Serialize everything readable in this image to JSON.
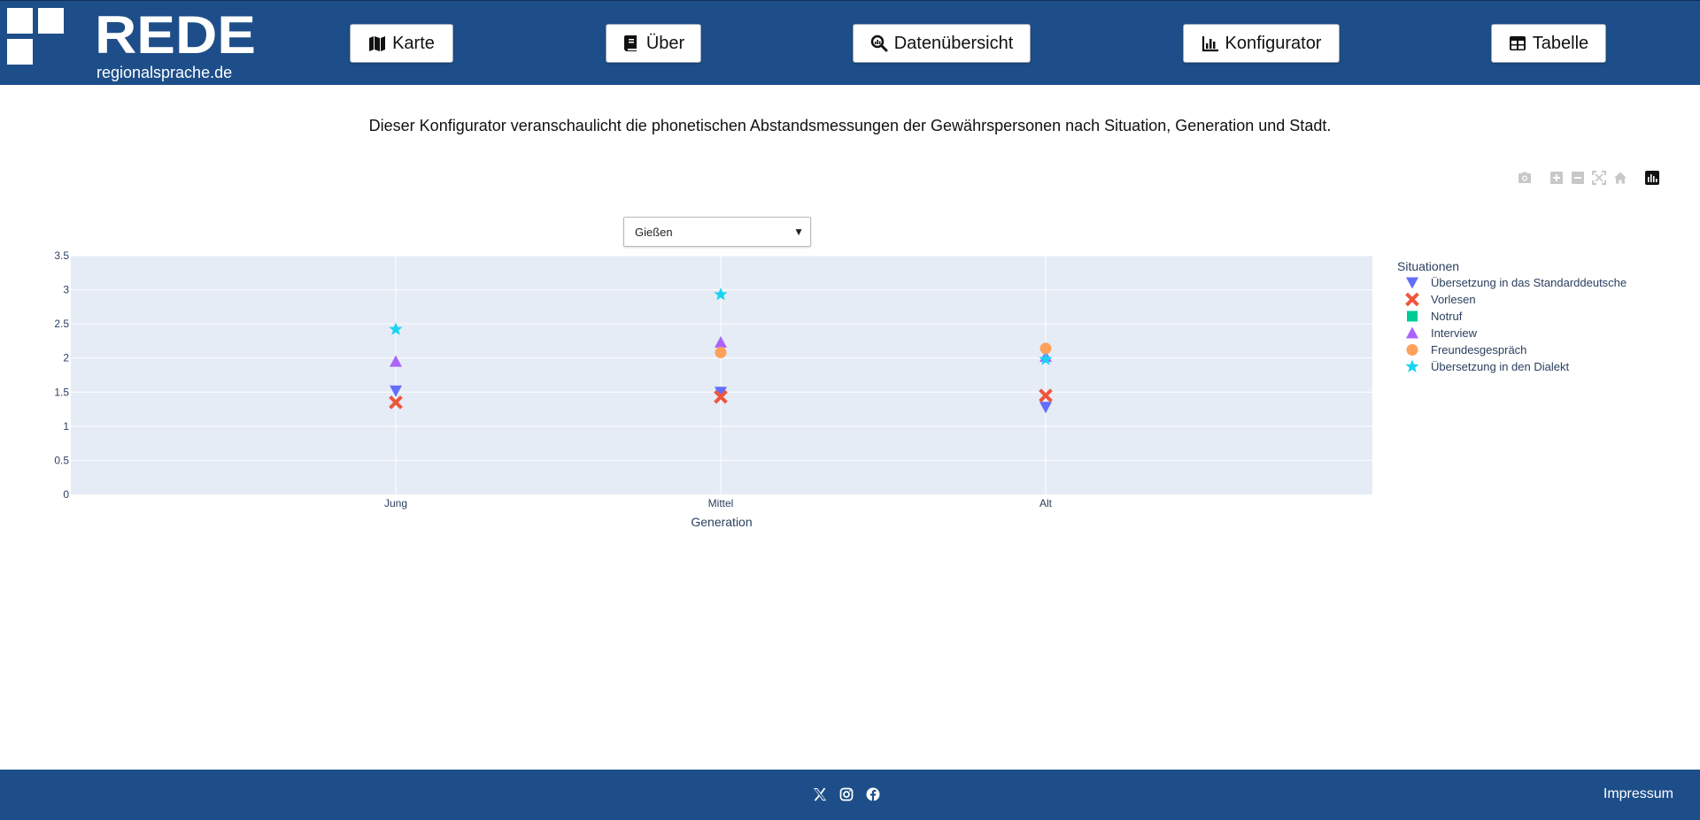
{
  "header": {
    "logo_text": "REDE",
    "logo_subtext": "regionalsprache.de",
    "nav": [
      {
        "label": "Karte",
        "icon": "map-icon"
      },
      {
        "label": "Über",
        "icon": "book-icon"
      },
      {
        "label": "Datenübersicht",
        "icon": "search-data-icon"
      },
      {
        "label": "Konfigurator",
        "icon": "chart-bar-icon"
      },
      {
        "label": "Tabelle",
        "icon": "table-icon"
      }
    ]
  },
  "intro_text": "Dieser Konfigurator veranschaulicht die phonetischen Abstandsmessungen der Gewährspersonen nach Situation, Generation und Stadt.",
  "modebar": [
    "camera-icon",
    "zoom-in-icon",
    "zoom-out-icon",
    "autoscale-icon",
    "reset-axes-icon",
    "plotly-logo-icon"
  ],
  "city_select": {
    "value": "Gießen",
    "arrow": "▼"
  },
  "chart_data": {
    "type": "scatter",
    "x": [
      "Jung",
      "Mittel",
      "Alt"
    ],
    "xlabel": "Generation",
    "ylabel": "",
    "ylim": [
      0,
      3.5
    ],
    "yticks": [
      "0",
      "0.5",
      "1",
      "1.5",
      "2",
      "2.5",
      "3",
      "3.5"
    ],
    "grid": true,
    "legend_title": "Situationen",
    "legend_position": "right",
    "series": [
      {
        "name": "Übersetzung in das Standarddeutsche",
        "symbol": "triangle-down",
        "color": "#636efa",
        "values": [
          1.52,
          1.5,
          1.28
        ]
      },
      {
        "name": "Vorlesen",
        "symbol": "x",
        "color": "#ef553b",
        "values": [
          1.35,
          1.43,
          1.45
        ]
      },
      {
        "name": "Notruf",
        "symbol": "square",
        "color": "#00cc96",
        "values": [
          null,
          null,
          null
        ]
      },
      {
        "name": "Interview",
        "symbol": "triangle-up",
        "color": "#ab63fa",
        "values": [
          1.95,
          2.23,
          2.02
        ]
      },
      {
        "name": "Freundesgespräch",
        "symbol": "circle",
        "color": "#ffa15a",
        "values": [
          null,
          2.08,
          2.14
        ]
      },
      {
        "name": "Übersetzung in den Dialekt",
        "symbol": "star",
        "color": "#19d3f3",
        "values": [
          2.42,
          2.93,
          1.98
        ]
      }
    ]
  },
  "footer": {
    "socials": [
      "x-twitter-icon",
      "instagram-icon",
      "facebook-icon"
    ],
    "impressum": "Impressum"
  },
  "colors": {
    "brand": "#1d4e89",
    "plot_bg": "#e5ecf6"
  }
}
